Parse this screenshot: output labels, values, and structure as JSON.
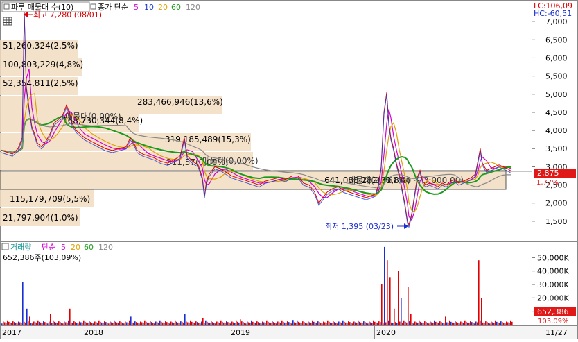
{
  "price_panel": {
    "title_box": "파루 매물대 수(10)",
    "legend": {
      "close_box": "종가 단순",
      "periods": [
        {
          "label": "5",
          "color": "#d400d4"
        },
        {
          "label": "10",
          "color": "#1a3ccf"
        },
        {
          "label": "20",
          "color": "#e0a000"
        },
        {
          "label": "60",
          "color": "#1a9a1a"
        },
        {
          "label": "120",
          "color": "#888888"
        }
      ]
    },
    "lc_label": "LC:106,09",
    "hc_label": "HC:-60,51",
    "current_price_label": "2,875",
    "pct_label": "1,77%",
    "high_annotation": "최고 7,280 (08/01)",
    "low_annotation": "최저 1,395 (03/23)",
    "volume_profile_labels": [
      "51,260,324(2,5%)",
      "100,803,229(4,8%)",
      "52,354,811(2,5%)",
      "283,466,946(13,6%)",
      "168,730,344(8,4%)",
      "319,185,489(15,3%)",
      "641,088,282(30,8%)",
      "115,179,709(5,5%)",
      "21,797,904(1,0%)"
    ],
    "range_box_labels": [
      "매물대(0,00%)",
      "매물대(0,00%)",
      "매물대(2,961,00 ~ 3,000,00)"
    ],
    "ma_overlay_label": "311,57(0,00%)"
  },
  "volume_panel": {
    "title_box": "거래량",
    "legend_ma": "단순",
    "legend": [
      {
        "label": "5",
        "color": "#d400d4"
      },
      {
        "label": "20",
        "color": "#e0a000"
      },
      {
        "label": "60",
        "color": "#1a9a1a"
      },
      {
        "label": "120",
        "color": "#888888"
      }
    ],
    "summary": "652,386주(103,09%)",
    "current_volume_label": "652,386",
    "pct_label": "103,09%"
  },
  "x_axis": {
    "labels": [
      "2017",
      "2018",
      "2019",
      "2020"
    ],
    "end_label": "11/27"
  },
  "chart_data": {
    "type": "line",
    "series": [
      {
        "values": [
          [
            0,
            3450
          ],
          [
            8,
            3400
          ],
          [
            16,
            3350
          ],
          [
            24,
            3500
          ],
          [
            30,
            3800
          ],
          [
            33,
            7280
          ],
          [
            36,
            5200
          ],
          [
            40,
            4600
          ],
          [
            44,
            4100
          ],
          [
            48,
            3900
          ],
          [
            52,
            3650
          ],
          [
            58,
            3550
          ],
          [
            64,
            3700
          ],
          [
            70,
            3900
          ],
          [
            76,
            4200
          ],
          [
            82,
            4300
          ],
          [
            88,
            4400
          ],
          [
            94,
            4700
          ],
          [
            98,
            4500
          ],
          [
            102,
            4200
          ],
          [
            108,
            4000
          ],
          [
            114,
            3900
          ],
          [
            120,
            3800
          ],
          [
            130,
            3700
          ],
          [
            140,
            3600
          ],
          [
            150,
            3500
          ],
          [
            160,
            3450
          ],
          [
            170,
            3500
          ],
          [
            180,
            3550
          ],
          [
            186,
            3800
          ],
          [
            190,
            3700
          ],
          [
            196,
            3450
          ],
          [
            204,
            3350
          ],
          [
            212,
            3300
          ],
          [
            220,
            3250
          ],
          [
            230,
            3150
          ],
          [
            240,
            3100
          ],
          [
            250,
            3200
          ],
          [
            258,
            3300
          ],
          [
            264,
            3800
          ],
          [
            268,
            3300
          ],
          [
            276,
            3150
          ],
          [
            284,
            3050
          ],
          [
            290,
            2700
          ],
          [
            293,
            2200
          ],
          [
            296,
            2600
          ],
          [
            300,
            2800
          ],
          [
            308,
            3000
          ],
          [
            316,
            2950
          ],
          [
            324,
            2850
          ],
          [
            332,
            2750
          ],
          [
            340,
            2700
          ],
          [
            348,
            2650
          ],
          [
            356,
            2600
          ],
          [
            364,
            2550
          ],
          [
            372,
            2500
          ],
          [
            380,
            2600
          ],
          [
            390,
            2650
          ],
          [
            400,
            2700
          ],
          [
            410,
            2650
          ],
          [
            420,
            2750
          ],
          [
            428,
            2750
          ],
          [
            436,
            2550
          ],
          [
            444,
            2500
          ],
          [
            452,
            2300
          ],
          [
            458,
            2000
          ],
          [
            464,
            2150
          ],
          [
            470,
            2300
          ],
          [
            478,
            2400
          ],
          [
            486,
            2450
          ],
          [
            494,
            2350
          ],
          [
            502,
            2300
          ],
          [
            510,
            2250
          ],
          [
            518,
            2200
          ],
          [
            526,
            2150
          ],
          [
            534,
            2200
          ],
          [
            540,
            2250
          ],
          [
            544,
            2500
          ],
          [
            548,
            3000
          ],
          [
            552,
            4500
          ],
          [
            556,
            5050
          ],
          [
            559,
            4200
          ],
          [
            562,
            3800
          ],
          [
            566,
            3500
          ],
          [
            570,
            3100
          ],
          [
            574,
            2800
          ],
          [
            578,
            2400
          ],
          [
            582,
            2000
          ],
          [
            586,
            1500
          ],
          [
            588,
            1395
          ],
          [
            592,
            1700
          ],
          [
            596,
            2200
          ],
          [
            600,
            2700
          ],
          [
            604,
            2900
          ],
          [
            608,
            2600
          ],
          [
            612,
            2500
          ],
          [
            618,
            2550
          ],
          [
            624,
            2500
          ],
          [
            630,
            2450
          ],
          [
            636,
            2550
          ],
          [
            642,
            2500
          ],
          [
            648,
            2600
          ],
          [
            654,
            2650
          ],
          [
            660,
            2550
          ],
          [
            666,
            2600
          ],
          [
            672,
            2650
          ],
          [
            678,
            2700
          ],
          [
            684,
            2800
          ],
          [
            688,
            3200
          ],
          [
            691,
            3500
          ],
          [
            694,
            3100
          ],
          [
            700,
            2900
          ],
          [
            706,
            2950
          ],
          [
            712,
            3000
          ],
          [
            718,
            3050
          ],
          [
            724,
            3000
          ],
          [
            730,
            2950
          ],
          [
            736,
            2875
          ]
        ]
      }
    ],
    "x_range": [
      0,
      736
    ],
    "ylim": [
      1000,
      7500
    ],
    "yticks": [
      1500,
      2000,
      2500,
      3000,
      3500,
      4000,
      4500,
      5000,
      5500,
      6000,
      6500,
      7000
    ],
    "ytick_labels": [
      "1,500",
      "2,000",
      "2,500",
      "3,000",
      "3,500",
      "4,000",
      "4,500",
      "5,000",
      "5,500",
      "6,000",
      "6,500",
      "7,000"
    ],
    "volume_ylim": [
      0,
      60000
    ],
    "volume_yticks": [
      10000,
      20000,
      30000,
      40000,
      50000
    ],
    "volume_ytick_labels": [
      "10,000K",
      "20,000K",
      "30,000K",
      "40,000K",
      "50,000K"
    ],
    "volume_spikes": [
      [
        30,
        32000
      ],
      [
        33,
        40000
      ],
      [
        36,
        12000
      ],
      [
        40,
        6000
      ],
      [
        70,
        8000
      ],
      [
        95,
        30000
      ],
      [
        98,
        12000
      ],
      [
        186,
        6000
      ],
      [
        264,
        8000
      ],
      [
        290,
        5000
      ],
      [
        344,
        4000
      ],
      [
        420,
        3000
      ],
      [
        548,
        30000
      ],
      [
        552,
        58000
      ],
      [
        556,
        48000
      ],
      [
        560,
        35000
      ],
      [
        566,
        12000
      ],
      [
        572,
        40000
      ],
      [
        576,
        20000
      ],
      [
        586,
        28000
      ],
      [
        590,
        8000
      ],
      [
        640,
        6000
      ],
      [
        688,
        48000
      ],
      [
        692,
        20000
      ]
    ]
  }
}
